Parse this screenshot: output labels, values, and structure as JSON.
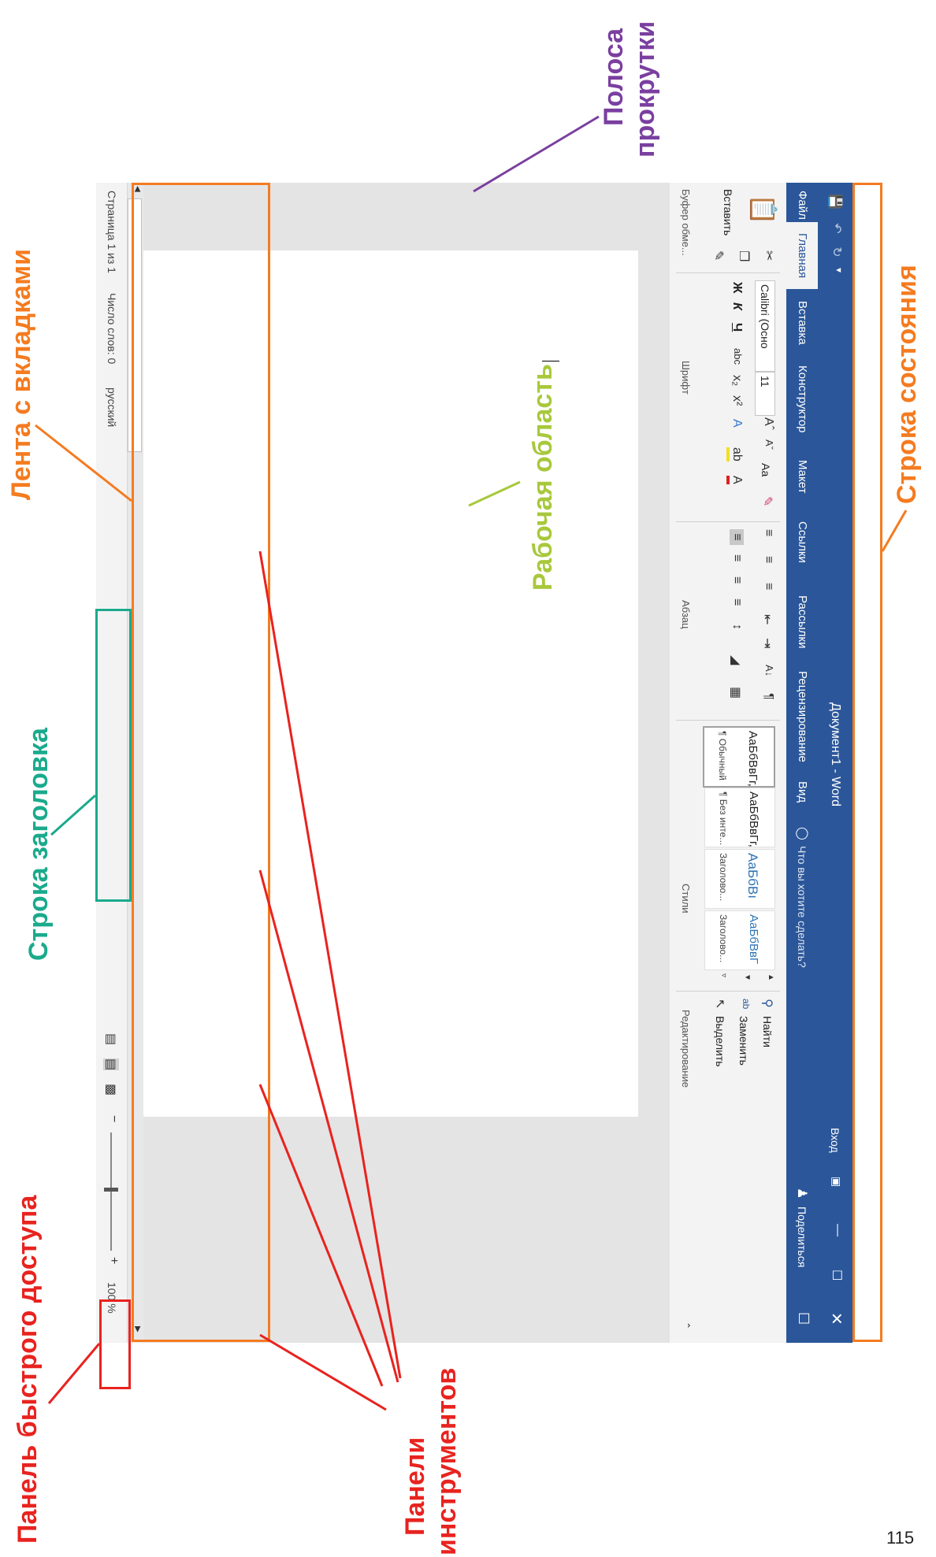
{
  "title_bar": {
    "document_title": "Документ1 - Word",
    "login": "Вход",
    "share": "Поделиться",
    "tell_me_placeholder": "Что вы хотите сделать?",
    "window_controls": [
      "minimize-icon",
      "restore-icon",
      "close-icon"
    ],
    "quick_access_icons": [
      "save-icon",
      "undo-icon",
      "redo-icon",
      "customize-icon"
    ]
  },
  "tabs": [
    "Файл",
    "Главная",
    "Вставка",
    "Конструктор",
    "Макет",
    "Ссылки",
    "Рассылки",
    "Рецензирование",
    "Вид"
  ],
  "ribbon": {
    "clipboard": {
      "paste": "Вставить",
      "label": "Буфер обме..."
    },
    "font": {
      "name": "Calibri (Осно",
      "size": "11",
      "bold": "Ж",
      "italic": "К",
      "underline": "Ч",
      "case": "Аа",
      "label": "Шрифт"
    },
    "paragraph": {
      "label": "Абзац"
    },
    "styles": {
      "items": [
        {
          "sample": "АаБбВвГг,",
          "name": "¶ Обычный"
        },
        {
          "sample": "АаБбВвГг,",
          "name": "¶ Без инте..."
        },
        {
          "sample": "АаБбВı",
          "name": "Заголово..."
        },
        {
          "sample": "АаБбВвГ",
          "name": "Заголово..."
        }
      ],
      "label": "Стили"
    },
    "editing": {
      "find": "Найти",
      "replace": "Заменить",
      "select": "Выделить",
      "label": "Редактирование"
    }
  },
  "status_bar": {
    "page": "Страница 1 из 1",
    "words": "Число слов: 0",
    "language": "русский",
    "zoom": "100 %"
  },
  "annotations": {
    "quick_access": "Панель быстрого доступа",
    "title_bar": "Строка заголовка",
    "ribbon": "Лента с вкладками",
    "scrollbar_line1": "Полоса",
    "scrollbar_line2": "прокрутки",
    "work_area": "Рабочая область",
    "status_bar": "Строка состояния",
    "toolbars_line1": "Панели",
    "toolbars_line2": "инструментов"
  },
  "colors": {
    "word_blue": "#2b579a",
    "orange": "#f47b20",
    "red": "#e8231f",
    "teal": "#1aaa8c",
    "green": "#a8c83c",
    "purple": "#7a3fa0"
  },
  "page_number": "115"
}
